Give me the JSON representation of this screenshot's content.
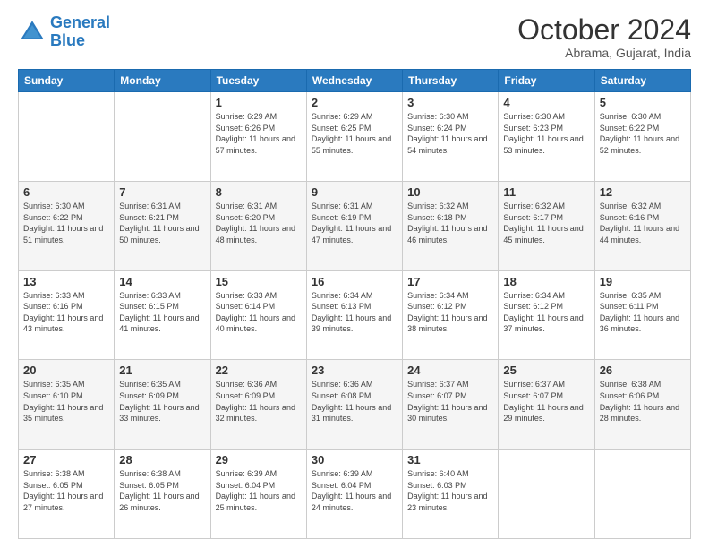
{
  "logo": {
    "line1": "General",
    "line2": "Blue"
  },
  "title": "October 2024",
  "subtitle": "Abrama, Gujarat, India",
  "weekdays": [
    "Sunday",
    "Monday",
    "Tuesday",
    "Wednesday",
    "Thursday",
    "Friday",
    "Saturday"
  ],
  "weeks": [
    [
      {
        "day": "",
        "sunrise": "",
        "sunset": "",
        "daylight": ""
      },
      {
        "day": "",
        "sunrise": "",
        "sunset": "",
        "daylight": ""
      },
      {
        "day": "1",
        "sunrise": "Sunrise: 6:29 AM",
        "sunset": "Sunset: 6:26 PM",
        "daylight": "Daylight: 11 hours and 57 minutes."
      },
      {
        "day": "2",
        "sunrise": "Sunrise: 6:29 AM",
        "sunset": "Sunset: 6:25 PM",
        "daylight": "Daylight: 11 hours and 55 minutes."
      },
      {
        "day": "3",
        "sunrise": "Sunrise: 6:30 AM",
        "sunset": "Sunset: 6:24 PM",
        "daylight": "Daylight: 11 hours and 54 minutes."
      },
      {
        "day": "4",
        "sunrise": "Sunrise: 6:30 AM",
        "sunset": "Sunset: 6:23 PM",
        "daylight": "Daylight: 11 hours and 53 minutes."
      },
      {
        "day": "5",
        "sunrise": "Sunrise: 6:30 AM",
        "sunset": "Sunset: 6:22 PM",
        "daylight": "Daylight: 11 hours and 52 minutes."
      }
    ],
    [
      {
        "day": "6",
        "sunrise": "Sunrise: 6:30 AM",
        "sunset": "Sunset: 6:22 PM",
        "daylight": "Daylight: 11 hours and 51 minutes."
      },
      {
        "day": "7",
        "sunrise": "Sunrise: 6:31 AM",
        "sunset": "Sunset: 6:21 PM",
        "daylight": "Daylight: 11 hours and 50 minutes."
      },
      {
        "day": "8",
        "sunrise": "Sunrise: 6:31 AM",
        "sunset": "Sunset: 6:20 PM",
        "daylight": "Daylight: 11 hours and 48 minutes."
      },
      {
        "day": "9",
        "sunrise": "Sunrise: 6:31 AM",
        "sunset": "Sunset: 6:19 PM",
        "daylight": "Daylight: 11 hours and 47 minutes."
      },
      {
        "day": "10",
        "sunrise": "Sunrise: 6:32 AM",
        "sunset": "Sunset: 6:18 PM",
        "daylight": "Daylight: 11 hours and 46 minutes."
      },
      {
        "day": "11",
        "sunrise": "Sunrise: 6:32 AM",
        "sunset": "Sunset: 6:17 PM",
        "daylight": "Daylight: 11 hours and 45 minutes."
      },
      {
        "day": "12",
        "sunrise": "Sunrise: 6:32 AM",
        "sunset": "Sunset: 6:16 PM",
        "daylight": "Daylight: 11 hours and 44 minutes."
      }
    ],
    [
      {
        "day": "13",
        "sunrise": "Sunrise: 6:33 AM",
        "sunset": "Sunset: 6:16 PM",
        "daylight": "Daylight: 11 hours and 43 minutes."
      },
      {
        "day": "14",
        "sunrise": "Sunrise: 6:33 AM",
        "sunset": "Sunset: 6:15 PM",
        "daylight": "Daylight: 11 hours and 41 minutes."
      },
      {
        "day": "15",
        "sunrise": "Sunrise: 6:33 AM",
        "sunset": "Sunset: 6:14 PM",
        "daylight": "Daylight: 11 hours and 40 minutes."
      },
      {
        "day": "16",
        "sunrise": "Sunrise: 6:34 AM",
        "sunset": "Sunset: 6:13 PM",
        "daylight": "Daylight: 11 hours and 39 minutes."
      },
      {
        "day": "17",
        "sunrise": "Sunrise: 6:34 AM",
        "sunset": "Sunset: 6:12 PM",
        "daylight": "Daylight: 11 hours and 38 minutes."
      },
      {
        "day": "18",
        "sunrise": "Sunrise: 6:34 AM",
        "sunset": "Sunset: 6:12 PM",
        "daylight": "Daylight: 11 hours and 37 minutes."
      },
      {
        "day": "19",
        "sunrise": "Sunrise: 6:35 AM",
        "sunset": "Sunset: 6:11 PM",
        "daylight": "Daylight: 11 hours and 36 minutes."
      }
    ],
    [
      {
        "day": "20",
        "sunrise": "Sunrise: 6:35 AM",
        "sunset": "Sunset: 6:10 PM",
        "daylight": "Daylight: 11 hours and 35 minutes."
      },
      {
        "day": "21",
        "sunrise": "Sunrise: 6:35 AM",
        "sunset": "Sunset: 6:09 PM",
        "daylight": "Daylight: 11 hours and 33 minutes."
      },
      {
        "day": "22",
        "sunrise": "Sunrise: 6:36 AM",
        "sunset": "Sunset: 6:09 PM",
        "daylight": "Daylight: 11 hours and 32 minutes."
      },
      {
        "day": "23",
        "sunrise": "Sunrise: 6:36 AM",
        "sunset": "Sunset: 6:08 PM",
        "daylight": "Daylight: 11 hours and 31 minutes."
      },
      {
        "day": "24",
        "sunrise": "Sunrise: 6:37 AM",
        "sunset": "Sunset: 6:07 PM",
        "daylight": "Daylight: 11 hours and 30 minutes."
      },
      {
        "day": "25",
        "sunrise": "Sunrise: 6:37 AM",
        "sunset": "Sunset: 6:07 PM",
        "daylight": "Daylight: 11 hours and 29 minutes."
      },
      {
        "day": "26",
        "sunrise": "Sunrise: 6:38 AM",
        "sunset": "Sunset: 6:06 PM",
        "daylight": "Daylight: 11 hours and 28 minutes."
      }
    ],
    [
      {
        "day": "27",
        "sunrise": "Sunrise: 6:38 AM",
        "sunset": "Sunset: 6:05 PM",
        "daylight": "Daylight: 11 hours and 27 minutes."
      },
      {
        "day": "28",
        "sunrise": "Sunrise: 6:38 AM",
        "sunset": "Sunset: 6:05 PM",
        "daylight": "Daylight: 11 hours and 26 minutes."
      },
      {
        "day": "29",
        "sunrise": "Sunrise: 6:39 AM",
        "sunset": "Sunset: 6:04 PM",
        "daylight": "Daylight: 11 hours and 25 minutes."
      },
      {
        "day": "30",
        "sunrise": "Sunrise: 6:39 AM",
        "sunset": "Sunset: 6:04 PM",
        "daylight": "Daylight: 11 hours and 24 minutes."
      },
      {
        "day": "31",
        "sunrise": "Sunrise: 6:40 AM",
        "sunset": "Sunset: 6:03 PM",
        "daylight": "Daylight: 11 hours and 23 minutes."
      },
      {
        "day": "",
        "sunrise": "",
        "sunset": "",
        "daylight": ""
      },
      {
        "day": "",
        "sunrise": "",
        "sunset": "",
        "daylight": ""
      }
    ]
  ]
}
